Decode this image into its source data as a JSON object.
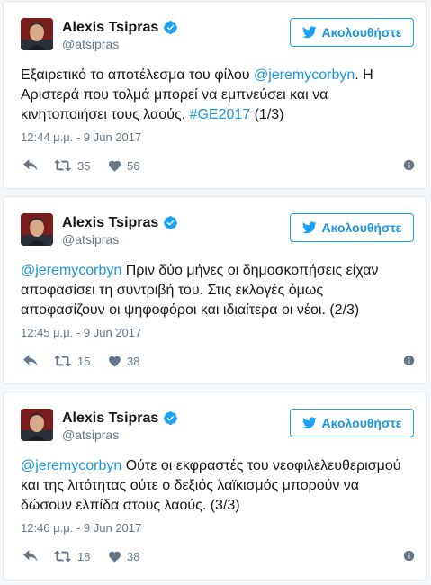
{
  "tweets": [
    {
      "name": "Alexis Tsipras",
      "handle": "@atsipras",
      "follow_label": "Ακολουθήστε",
      "text_parts": [
        {
          "text": "Εξαιρετικό το αποτέλεσμα του φίλου ",
          "link": false
        },
        {
          "text": "@jeremycorbyn",
          "link": true
        },
        {
          "text": ". Η Αριστερά που τολμά μπορεί να εμπνεύσει και να κινητοποιήσει τους λαούς. ",
          "link": false
        },
        {
          "text": "#GE2017",
          "link": true
        },
        {
          "text": " (1/3)",
          "link": false
        }
      ],
      "timestamp": "12:44 μ.μ. - 9 Jun 2017",
      "retweets": "35",
      "likes": "56"
    },
    {
      "name": "Alexis Tsipras",
      "handle": "@atsipras",
      "follow_label": "Ακολουθήστε",
      "text_parts": [
        {
          "text": "@jeremycorbyn",
          "link": true
        },
        {
          "text": " Πριν δύο μήνες οι δημοσκοπήσεις είχαν αποφασίσει τη συντριβή του. Στις εκλογές όμως αποφασίζουν οι ψηφοφόροι και ιδιαίτερα οι νέοι. (2/3)",
          "link": false
        }
      ],
      "timestamp": "12:45 μ.μ. - 9 Jun 2017",
      "retweets": "15",
      "likes": "38"
    },
    {
      "name": "Alexis Tsipras",
      "handle": "@atsipras",
      "follow_label": "Ακολουθήστε",
      "text_parts": [
        {
          "text": "@jeremycorbyn",
          "link": true
        },
        {
          "text": " Ούτε οι εκφραστές του νεοφιλελευθερισμού και της λιτότητας ούτε ο δεξιός λαϊκισμός μπορούν να δώσουν ελπίδα στους λαούς. (3/3)",
          "link": false
        }
      ],
      "timestamp": "12:46 μ.μ. - 9 Jun 2017",
      "retweets": "18",
      "likes": "38"
    }
  ],
  "icons": {
    "avatar": "profile-photo",
    "verified": "verified-badge-icon",
    "follow": "twitter-bird-icon",
    "reply": "reply-icon",
    "retweet": "retweet-icon",
    "like": "heart-icon",
    "info": "info-icon"
  },
  "colors": {
    "accent": "#1da1f2",
    "link": "#1b95e0",
    "muted": "#657786",
    "border": "#e1e8ed"
  }
}
